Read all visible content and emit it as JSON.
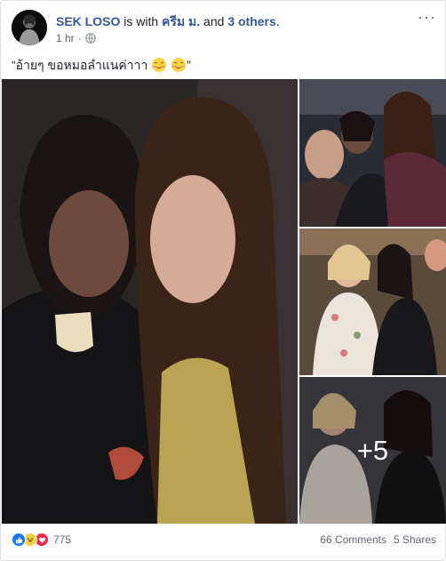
{
  "post": {
    "author": "SEK LOSO",
    "with_text": " is with ",
    "tagged_person": "ครีม ม.",
    "and_text": " and ",
    "others": "3 others",
    "period": ".",
    "time": "1 hr",
    "time_sep": "·",
    "privacy_icon": "globe-icon",
    "more_icon": "ellipsis-icon",
    "message": "“อ้ายๆ ขอหมอลำแนค่าาา",
    "message_end": "”",
    "emoji_icon": "smiling-face-icon"
  },
  "photos": {
    "extra_count": "+5"
  },
  "footer": {
    "reaction_icons": [
      "like-icon",
      "haha-icon",
      "love-icon"
    ],
    "reaction_count": "775",
    "comments": "66 Comments",
    "shares": "5 Shares"
  },
  "colors": {
    "link": "#365899",
    "text": "#1d2129",
    "meta": "#616770",
    "like": "#1877f2",
    "love": "#f0284a",
    "haha": "#fbd043"
  }
}
